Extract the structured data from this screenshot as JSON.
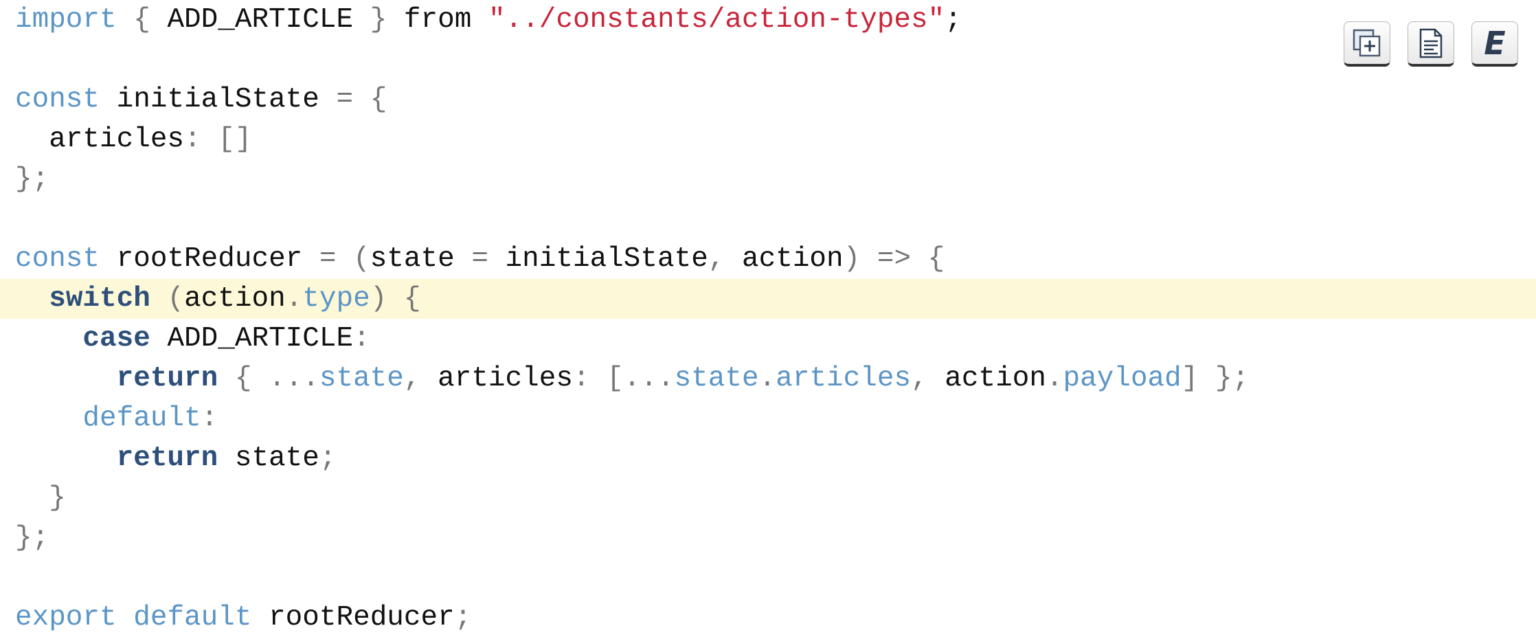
{
  "code": {
    "line1": {
      "kw1": "import",
      "p1": " { ",
      "id1": "ADD_ARTICLE",
      "p2": " } ",
      "id2": "from",
      "p3": " ",
      "str": "\"../constants/action-types\"",
      "p4": ";"
    },
    "line3": {
      "kw1": "const",
      "id1": " initialState ",
      "p1": "= {"
    },
    "line4": {
      "id1": "  articles",
      "p1": ": []"
    },
    "line5": {
      "p1": "};"
    },
    "line7": {
      "kw1": "const",
      "id1": " rootReducer ",
      "p1": "= (",
      "id2": "state",
      "p2": " = ",
      "id3": "initialState",
      "p3": ", ",
      "id4": "action",
      "p4": ") => {"
    },
    "line8": {
      "indent": "  ",
      "kw1": "switch",
      "p1": " (",
      "id1": "action",
      "p2": ".",
      "prop1": "type",
      "p3": ") {"
    },
    "line9": {
      "indent": "    ",
      "kw1": "case",
      "id1": " ADD_ARTICLE",
      "p1": ":"
    },
    "line10": {
      "indent": "      ",
      "kw1": "return",
      "p1": " { ...",
      "prop1": "state",
      "p2": ", ",
      "id1": "articles",
      "p3": ": [...",
      "prop2": "state",
      "p4": ".",
      "prop3": "articles",
      "p5": ", ",
      "id2": "action",
      "p6": ".",
      "prop4": "payload",
      "p7": "] };"
    },
    "line11": {
      "indent": "    ",
      "kw1": "default",
      "p1": ":"
    },
    "line12": {
      "indent": "      ",
      "kw1": "return",
      "id1": " state",
      "p1": ";"
    },
    "line13": {
      "p1": "  }"
    },
    "line14": {
      "p1": "};"
    },
    "line16": {
      "kw1": "export",
      "p1": " ",
      "kw2": "default",
      "id1": " rootReducer",
      "p2": ";"
    }
  },
  "toolbar": {
    "buttons": [
      {
        "icon": "add-snippet-icon"
      },
      {
        "icon": "document-icon"
      },
      {
        "icon": "expand-icon",
        "label": "E"
      }
    ]
  },
  "colors": {
    "keyword": "#5b95c6",
    "keyword_bold": "#2d4f7a",
    "string": "#c8253a",
    "punctuation": "#777777",
    "highlight": "#fdf9d8"
  }
}
